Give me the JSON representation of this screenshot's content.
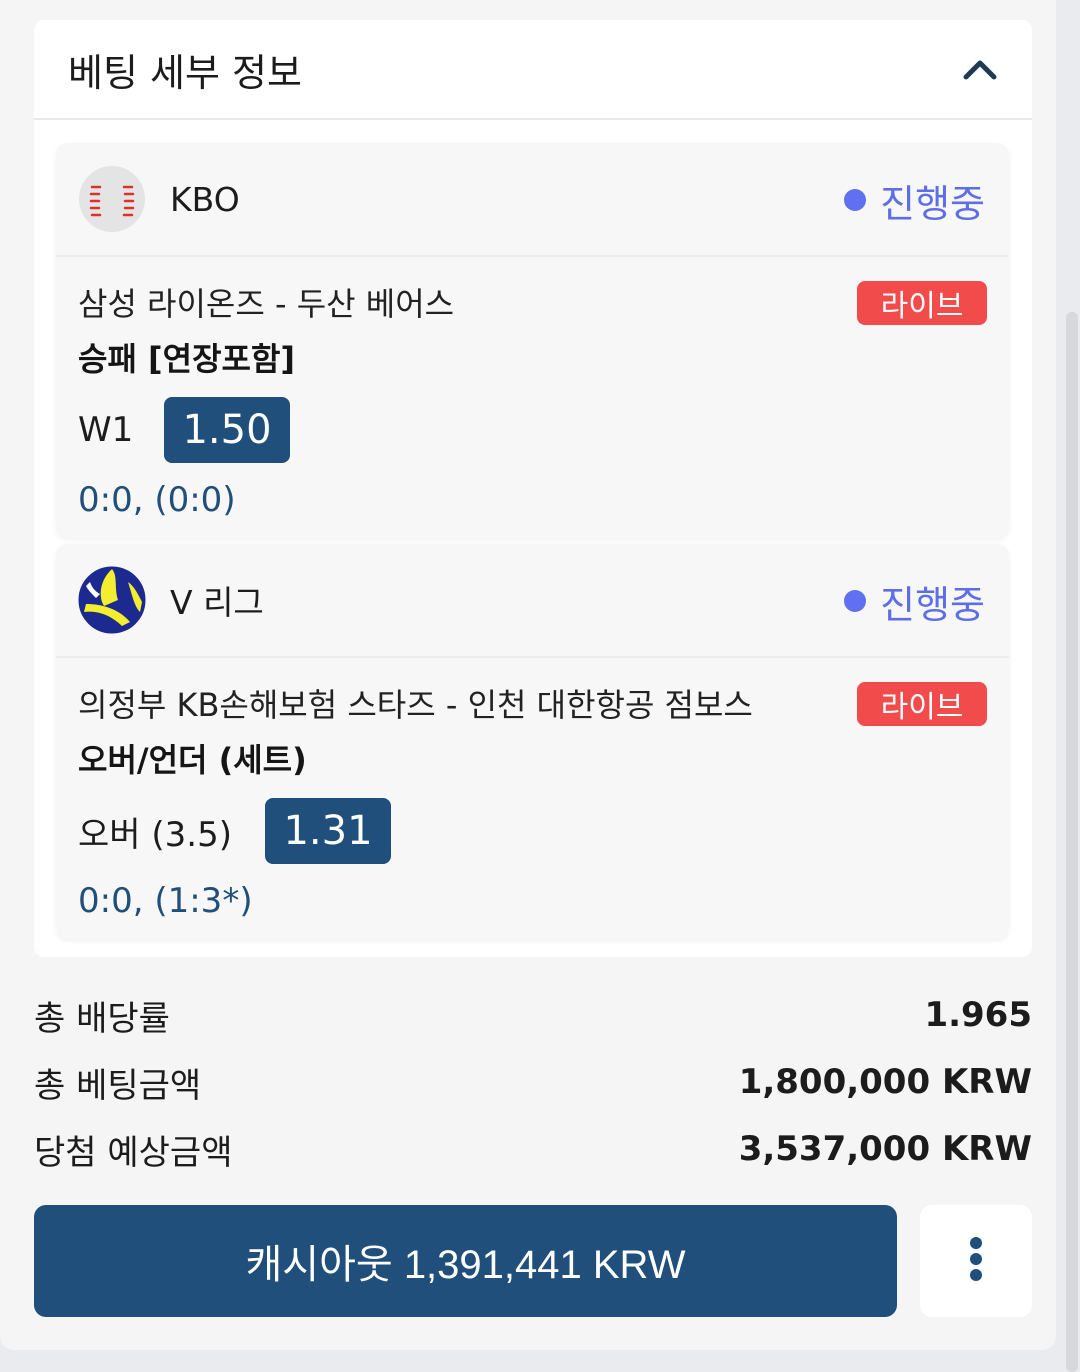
{
  "panel": {
    "title": "베팅 세부 정보"
  },
  "bets": [
    {
      "league": "KBO",
      "status": "진행중",
      "match": "삼성 라이온즈 - 두산 베어스",
      "badge": "라이브",
      "market": "승패 [연장포함]",
      "pick": "W1",
      "odds": "1.50",
      "score": "0:0, (0:0)"
    },
    {
      "league": "V 리그",
      "status": "진행중",
      "match": "의정부 KB손해보험 스타즈 - 인천 대한항공 점보스",
      "badge": "라이브",
      "market": "오버/언더 (세트)",
      "pick": "오버 (3.5)",
      "odds": "1.31",
      "score": "0:0, (1:3*)"
    }
  ],
  "summary": {
    "total_odds_label": "총 배당률",
    "total_odds_value": "1.965",
    "total_stake_label": "총 베팅금액",
    "total_stake_value": "1,800,000 KRW",
    "expected_win_label": "당첨 예상금액",
    "expected_win_value": "3,537,000 KRW"
  },
  "actions": {
    "cashout_label": "캐시아웃 1,391,441 KRW"
  },
  "icons": {
    "collapse": "chevron-up-icon",
    "more": "more-vertical-icon",
    "league_1": "baseball-icon",
    "league_2": "volleyball-icon"
  },
  "colors": {
    "primary": "#1f4f7a",
    "live": "#f14b4b",
    "status": "#5e6ee6"
  }
}
